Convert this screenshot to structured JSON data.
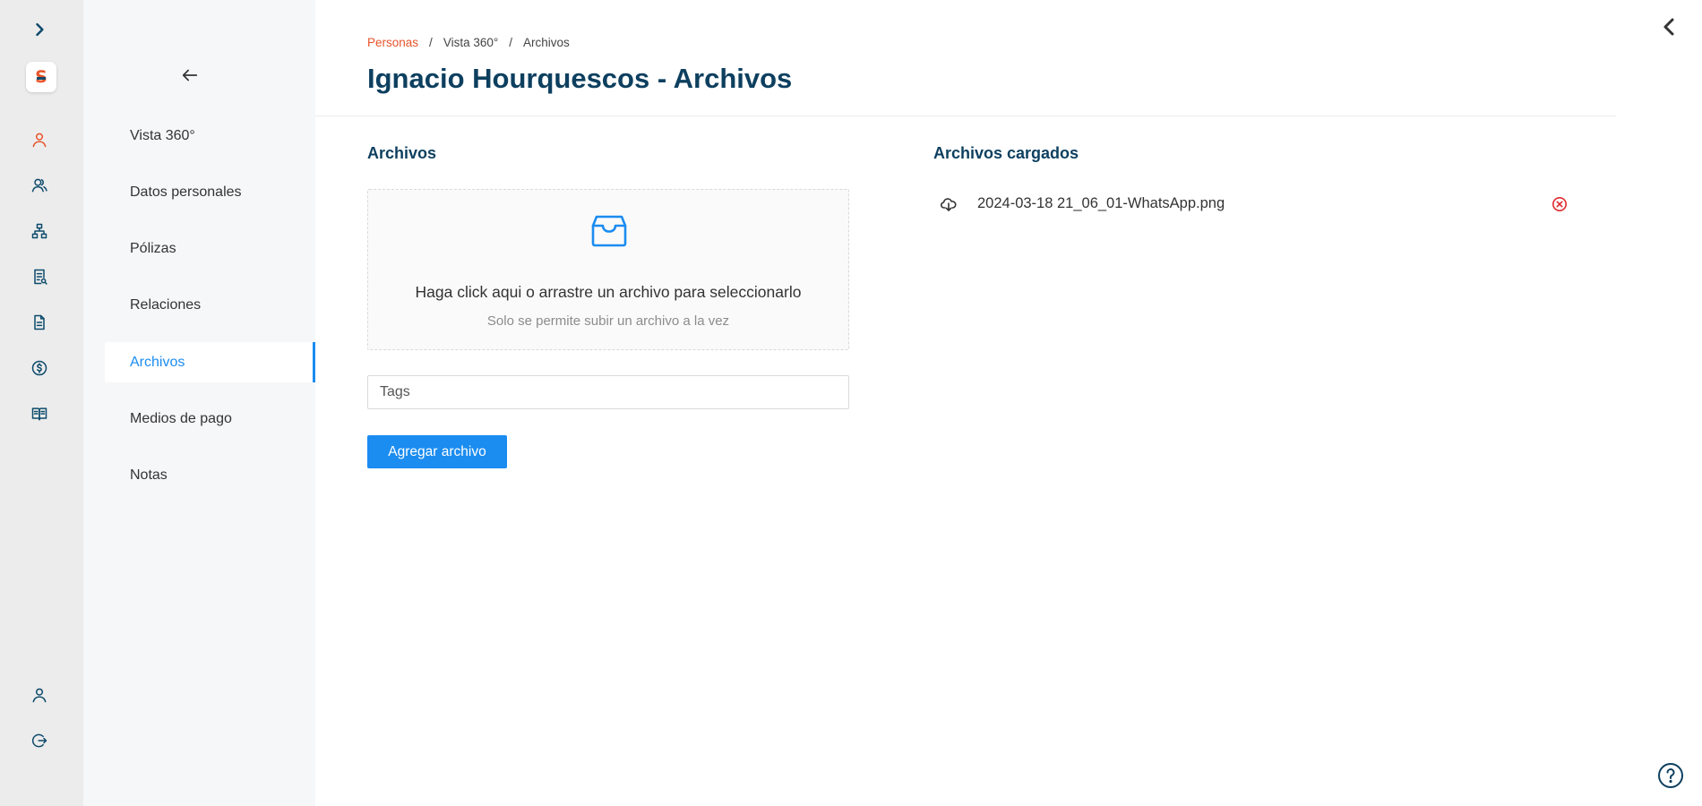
{
  "app": {
    "logo_text": "S",
    "brand_colors": {
      "primary": "#1b8cf0",
      "accent": "#e8542a",
      "dark": "#0d3f5f",
      "danger": "#e0282e"
    }
  },
  "rail": {
    "items": [
      {
        "icon": "chevron-right-icon"
      },
      {
        "icon": "person-icon"
      },
      {
        "icon": "people-icon"
      },
      {
        "icon": "org-chart-icon"
      },
      {
        "icon": "policy-document-icon"
      },
      {
        "icon": "document-icon"
      },
      {
        "icon": "dollar-icon"
      },
      {
        "icon": "book-icon"
      },
      {
        "icon": "user-profile-icon"
      },
      {
        "icon": "logout-icon"
      }
    ]
  },
  "subnav": {
    "back_icon": "arrow-left-icon",
    "items": [
      {
        "label": "Vista 360°"
      },
      {
        "label": "Datos personales"
      },
      {
        "label": "Pólizas"
      },
      {
        "label": "Relaciones"
      },
      {
        "label": "Archivos",
        "active": true
      },
      {
        "label": "Medios de pago"
      },
      {
        "label": "Notas"
      }
    ]
  },
  "header": {
    "breadcrumb": [
      {
        "label": "Personas"
      },
      {
        "label": "Vista 360°"
      },
      {
        "label": "Archivos"
      }
    ],
    "separator": "/",
    "title": "Ignacio Hourquescos - Archivos"
  },
  "upload": {
    "section_title": "Archivos",
    "dropzone_icon": "inbox-icon",
    "dropzone_title": "Haga click aqui o arrastre un archivo para seleccionarlo",
    "dropzone_hint": "Solo se permite subir un archivo a la vez",
    "tags_placeholder": "Tags",
    "tags_value": "",
    "submit_label": "Agregar archivo"
  },
  "uploaded": {
    "section_title": "Archivos cargados",
    "files": [
      {
        "name": "2024-03-18 21_06_01-WhatsApp.png",
        "icon": "cloud-download-icon",
        "remove_icon": "remove-circle-icon"
      }
    ]
  }
}
